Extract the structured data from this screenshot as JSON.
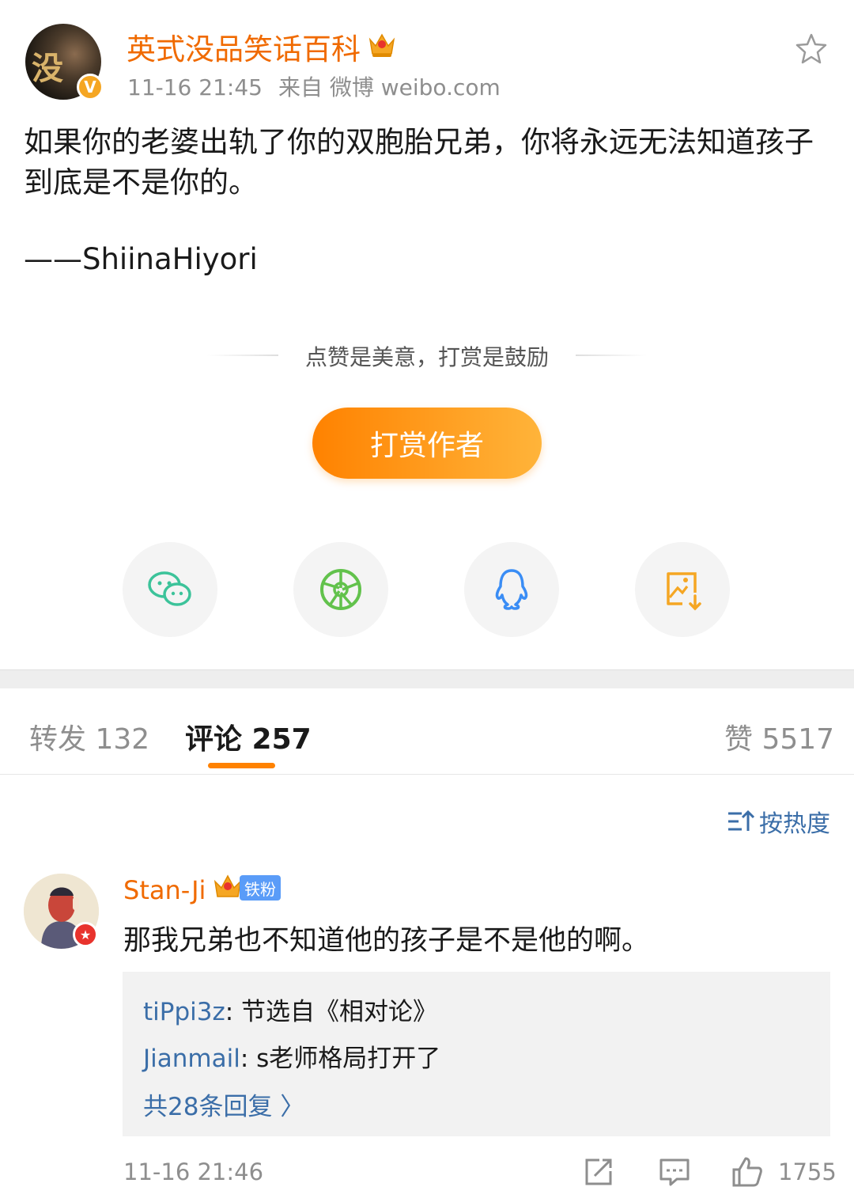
{
  "post": {
    "username": "英式没品笑话百科",
    "avatar_glyph": "没",
    "verified_badge": "V",
    "time": "11-16 21:45",
    "source": "来自 微博 weibo.com",
    "text": "如果你的老婆出轨了你的双胞胎兄弟，你将永远无法知道孩子到底是不是你的。",
    "signature": "——ShiinaHiyori"
  },
  "reward": {
    "slogan": "点赞是美意，打赏是鼓励",
    "button_label": "打赏作者"
  },
  "share": {
    "icons": [
      "wechat-icon",
      "moments-icon",
      "qq-icon",
      "save-image-icon"
    ]
  },
  "tabs": {
    "repost": "转发 132",
    "comment": "评论 257",
    "like": "赞 5517"
  },
  "sort_label": "按热度",
  "comment": {
    "username": "Stan-Ji",
    "fan_badge": "铁粉",
    "text": "那我兄弟也不知道他的孩子是不是他的啊。",
    "replies": [
      {
        "user": "tiPpi3z",
        "text": ": 节选自《相对论》"
      },
      {
        "user": "Jianmail",
        "text": ": s老师格局打开了"
      }
    ],
    "more_replies": "共28条回复 〉",
    "time": "11-16 21:46",
    "like_count": "1755"
  },
  "colors": {
    "accent_orange": "#ff8200",
    "username_orange": "#f06a00",
    "link_blue": "#3b6ea8"
  }
}
